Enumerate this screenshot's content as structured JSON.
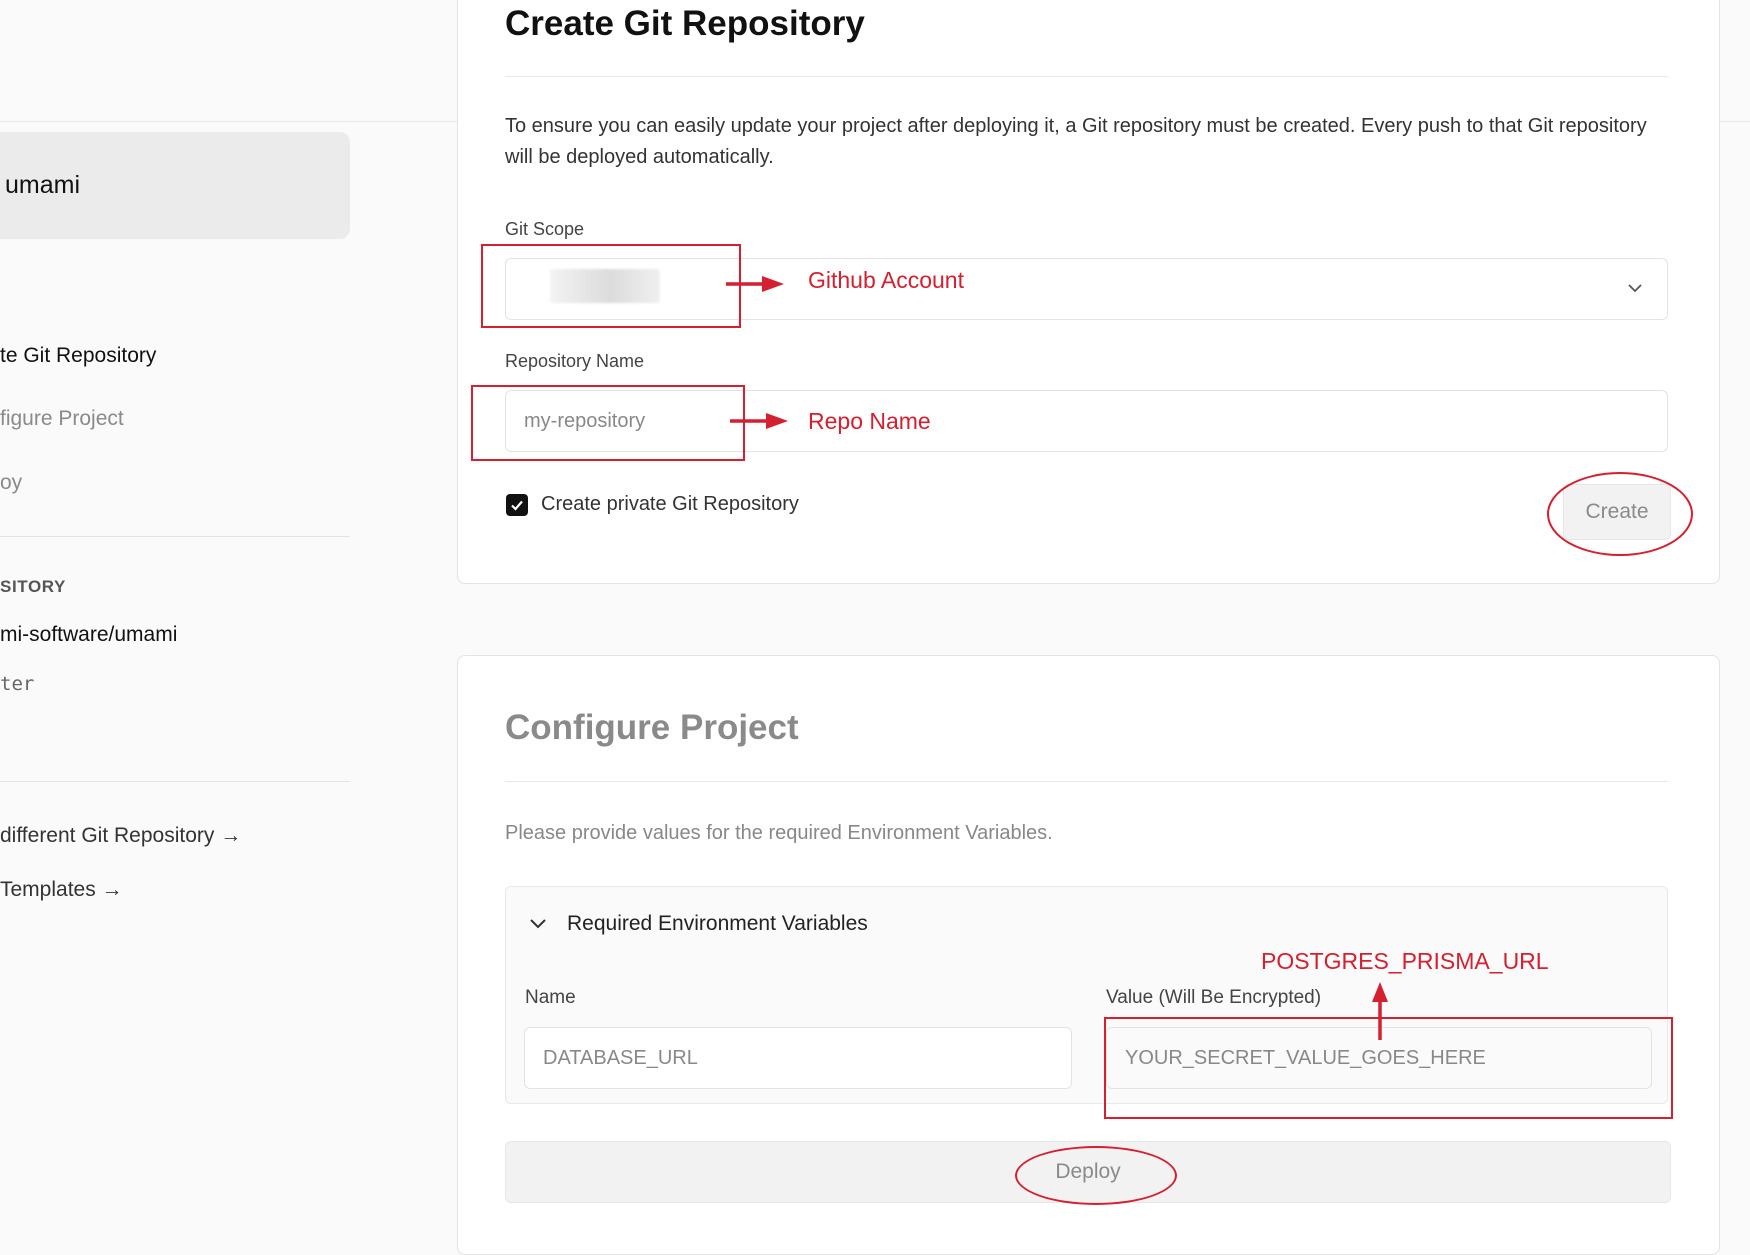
{
  "sidebar": {
    "project_name": "umami",
    "steps": [
      {
        "label": "te Git Repository",
        "state": "active"
      },
      {
        "label": "figure Project",
        "state": "inactive"
      },
      {
        "label": "oy",
        "state": "inactive"
      }
    ],
    "repository": {
      "heading": "SITORY",
      "name": "mi-software/umami",
      "branch": "ter"
    },
    "links": [
      {
        "label": "different Git Repository →"
      },
      {
        "label": "Templates →"
      }
    ]
  },
  "create_repo": {
    "title": "Create Git Repository",
    "description": "To ensure you can easily update your project after deploying it, a Git repository must be created. Every push to that Git repository will be deployed automatically.",
    "git_scope_label": "Git Scope",
    "repo_name_label": "Repository Name",
    "repo_name_placeholder": "my-repository",
    "private_checkbox_label": "Create private Git Repository",
    "private_checked": true,
    "create_button": "Create"
  },
  "configure_project": {
    "title": "Configure Project",
    "description": "Please provide values for the required Environment Variables.",
    "env_section_title": "Required Environment Variables",
    "name_label": "Name",
    "value_label": "Value (Will Be Encrypted)",
    "name_value": "DATABASE_URL",
    "value_placeholder": "YOUR_SECRET_VALUE_GOES_HERE",
    "deploy_button": "Deploy"
  },
  "annotations": {
    "git_scope": "Github Account",
    "repo_name": "Repo Name",
    "env_value": "POSTGRES_PRISMA_URL",
    "color": "#d42030"
  }
}
